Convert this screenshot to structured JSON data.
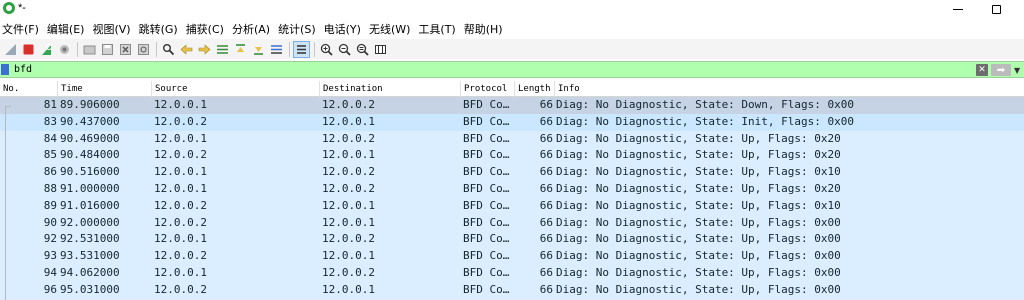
{
  "window": {
    "title": "*-"
  },
  "menu": [
    "文件(F)",
    "编辑(E)",
    "视图(V)",
    "跳转(G)",
    "捕获(C)",
    "分析(A)",
    "统计(S)",
    "电话(Y)",
    "无线(W)",
    "工具(T)",
    "帮助(H)"
  ],
  "toolbar": {
    "icons": [
      "shark-fin-start-icon",
      "stop-icon",
      "restart-icon",
      "options-icon",
      "open-icon",
      "save-icon",
      "close-file-icon",
      "reload-icon",
      "find-icon",
      "back-icon",
      "forward-icon",
      "goto-icon",
      "first-packet-icon",
      "last-packet-icon",
      "autoscroll-icon",
      "colorize-icon",
      "zoom-in-icon",
      "zoom-out-icon",
      "zoom-normal-icon",
      "resize-columns-icon"
    ]
  },
  "filter": {
    "value": "bfd"
  },
  "columns": [
    "No.",
    "Time",
    "Source",
    "Destination",
    "Protocol",
    "Length",
    "Info"
  ],
  "packets": [
    {
      "no": "81",
      "time": "89.906000",
      "src": "12.0.0.1",
      "dst": "12.0.0.2",
      "proto": "BFD Co…",
      "len": "66",
      "info": "Diag: No Diagnostic, State: Down, Flags: 0x00",
      "style": "sel"
    },
    {
      "no": "83",
      "time": "90.437000",
      "src": "12.0.0.2",
      "dst": "12.0.0.1",
      "proto": "BFD Co…",
      "len": "66",
      "info": "Diag: No Diagnostic, State: Init, Flags: 0x00",
      "style": "hl"
    },
    {
      "no": "84",
      "time": "90.469000",
      "src": "12.0.0.1",
      "dst": "12.0.0.2",
      "proto": "BFD Co…",
      "len": "66",
      "info": "Diag: No Diagnostic, State: Up, Flags: 0x20",
      "style": ""
    },
    {
      "no": "85",
      "time": "90.484000",
      "src": "12.0.0.2",
      "dst": "12.0.0.1",
      "proto": "BFD Co…",
      "len": "66",
      "info": "Diag: No Diagnostic, State: Up, Flags: 0x20",
      "style": ""
    },
    {
      "no": "86",
      "time": "90.516000",
      "src": "12.0.0.1",
      "dst": "12.0.0.2",
      "proto": "BFD Co…",
      "len": "66",
      "info": "Diag: No Diagnostic, State: Up, Flags: 0x10",
      "style": ""
    },
    {
      "no": "88",
      "time": "91.000000",
      "src": "12.0.0.1",
      "dst": "12.0.0.2",
      "proto": "BFD Co…",
      "len": "66",
      "info": "Diag: No Diagnostic, State: Up, Flags: 0x20",
      "style": ""
    },
    {
      "no": "89",
      "time": "91.016000",
      "src": "12.0.0.2",
      "dst": "12.0.0.1",
      "proto": "BFD Co…",
      "len": "66",
      "info": "Diag: No Diagnostic, State: Up, Flags: 0x10",
      "style": ""
    },
    {
      "no": "90",
      "time": "92.000000",
      "src": "12.0.0.2",
      "dst": "12.0.0.1",
      "proto": "BFD Co…",
      "len": "66",
      "info": "Diag: No Diagnostic, State: Up, Flags: 0x00",
      "style": ""
    },
    {
      "no": "92",
      "time": "92.531000",
      "src": "12.0.0.1",
      "dst": "12.0.0.2",
      "proto": "BFD Co…",
      "len": "66",
      "info": "Diag: No Diagnostic, State: Up, Flags: 0x00",
      "style": ""
    },
    {
      "no": "93",
      "time": "93.531000",
      "src": "12.0.0.2",
      "dst": "12.0.0.1",
      "proto": "BFD Co…",
      "len": "66",
      "info": "Diag: No Diagnostic, State: Up, Flags: 0x00",
      "style": ""
    },
    {
      "no": "94",
      "time": "94.062000",
      "src": "12.0.0.1",
      "dst": "12.0.0.2",
      "proto": "BFD Co…",
      "len": "66",
      "info": "Diag: No Diagnostic, State: Up, Flags: 0x00",
      "style": ""
    },
    {
      "no": "96",
      "time": "95.031000",
      "src": "12.0.0.2",
      "dst": "12.0.0.1",
      "proto": "BFD Co…",
      "len": "66",
      "info": "Diag: No Diagnostic, State: Up, Flags: 0x00",
      "style": ""
    }
  ],
  "colors": {
    "filter_ok": "#afffaf",
    "row_bg": "#dbeeff",
    "row_selected": "#c6d3e5",
    "row_highlight": "#cbe6ff"
  }
}
